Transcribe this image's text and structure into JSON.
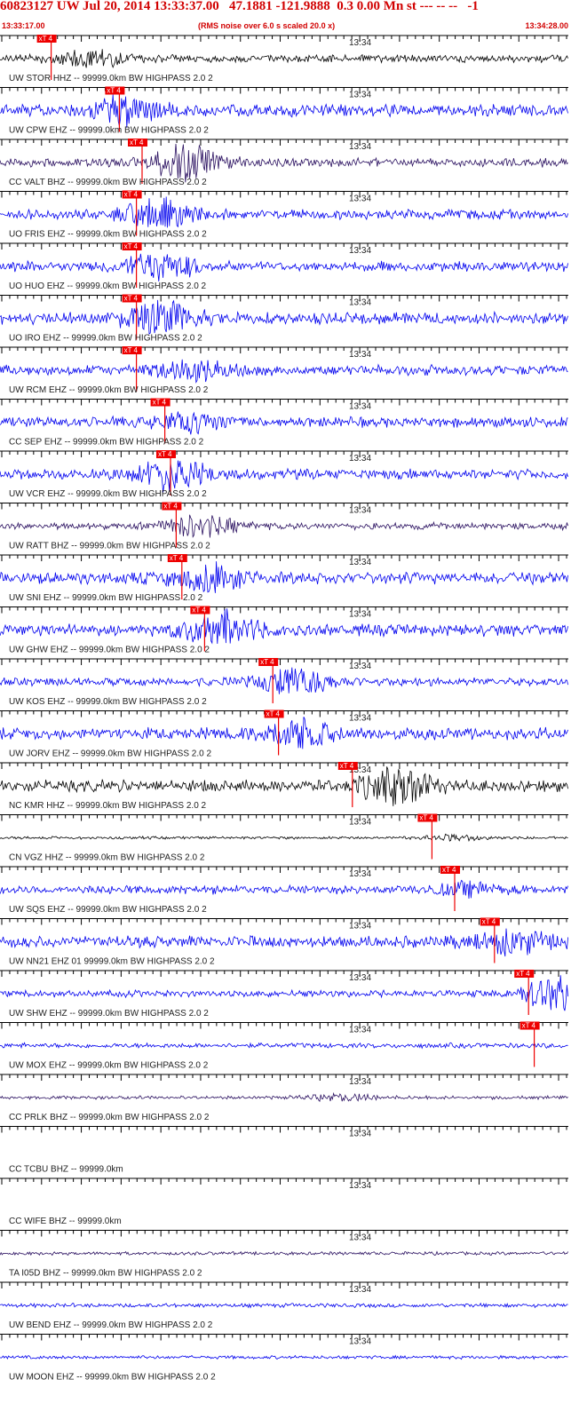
{
  "header": {
    "title": "60823127 UW Jul 20, 2014 13:33:37.00   47.1881 -121.9888  0.3 0.00 Mn st --- -- --   -1",
    "start_time": "13:33:17.00",
    "note": "(RMS noise over 6.0 s scaled 20.0 x)",
    "end_time": "13:34:28.00"
  },
  "tick_label": "13:34",
  "pick_label": "xT 4",
  "colors": {
    "header": "#d10000",
    "pick": "#ee0000",
    "axis": "#000000",
    "blue": "#0000ee",
    "navy": "#2a1060",
    "black": "#000000"
  },
  "channels": [
    {
      "label": "UW STOR HHZ -- 99999.0km BW  HIGHPASS  2.0  2",
      "color": "black",
      "pick": 0.09,
      "burst": 0.16,
      "amp": 0.22,
      "bamp": 0.5
    },
    {
      "label": "UW CPW EHZ -- 99999.0km BW  HIGHPASS  2.0  2",
      "color": "blue",
      "pick": 0.21,
      "burst": 0.22,
      "amp": 0.35,
      "bamp": 0.7
    },
    {
      "label": "CC VALT BHZ -- 99999.0km BW  HIGHPASS  2.0  2",
      "color": "navy",
      "pick": 0.25,
      "burst": 0.33,
      "amp": 0.25,
      "bamp": 1.0
    },
    {
      "label": "UO FRIS EHZ -- 99999.0km BW  HIGHPASS  2.0  2",
      "color": "blue",
      "pick": 0.24,
      "burst": 0.28,
      "amp": 0.28,
      "bamp": 0.8
    },
    {
      "label": "UO HUO EHZ -- 99999.0km BW  HIGHPASS  2.0  2",
      "color": "blue",
      "pick": 0.24,
      "burst": 0.28,
      "amp": 0.3,
      "bamp": 0.7
    },
    {
      "label": "UO IRO EHZ -- 99999.0km BW  HIGHPASS  2.0  2",
      "color": "blue",
      "pick": 0.24,
      "burst": 0.28,
      "amp": 0.35,
      "bamp": 0.9
    },
    {
      "label": "UW RCM EHZ -- 99999.0km BW  HIGHPASS  2.0  2",
      "color": "blue",
      "pick": 0.24,
      "burst": 0.34,
      "amp": 0.3,
      "bamp": 0.6
    },
    {
      "label": "CC SEP EHZ -- 99999.0km BW  HIGHPASS  2.0  2",
      "color": "blue",
      "pick": 0.29,
      "burst": 0.34,
      "amp": 0.3,
      "bamp": 0.5
    },
    {
      "label": "UW VCR EHZ -- 99999.0km BW  HIGHPASS  2.0  2",
      "color": "blue",
      "pick": 0.3,
      "burst": 0.3,
      "amp": 0.3,
      "bamp": 0.9
    },
    {
      "label": "UW RATT BHZ -- 99999.0km BW  HIGHPASS  2.0  2",
      "color": "navy",
      "pick": 0.31,
      "burst": 0.35,
      "amp": 0.2,
      "bamp": 0.6
    },
    {
      "label": "UW SNI EHZ -- 99999.0km BW  HIGHPASS  2.0  2",
      "color": "blue",
      "pick": 0.32,
      "burst": 0.37,
      "amp": 0.35,
      "bamp": 0.7
    },
    {
      "label": "UW GHW EHZ -- 99999.0km BW  HIGHPASS  2.0  2",
      "color": "blue",
      "pick": 0.36,
      "burst": 0.39,
      "amp": 0.35,
      "bamp": 0.9
    },
    {
      "label": "UW KOS EHZ -- 99999.0km BW  HIGHPASS  2.0  2",
      "color": "blue",
      "pick": 0.48,
      "burst": 0.52,
      "amp": 0.25,
      "bamp": 0.8
    },
    {
      "label": "UW JORV EHZ -- 99999.0km BW  HIGHPASS  2.0  2",
      "color": "blue",
      "pick": 0.49,
      "burst": 0.52,
      "amp": 0.35,
      "bamp": 0.8
    },
    {
      "label": "NC KMR HHZ -- 99999.0km BW  HIGHPASS  2.0  2",
      "color": "black",
      "pick": 0.62,
      "burst": 0.7,
      "amp": 0.35,
      "bamp": 1.0
    },
    {
      "label": "CN VGZ HHZ -- 99999.0km BW  HIGHPASS  2.0  2",
      "color": "black",
      "pick": 0.76,
      "burst": 0.8,
      "amp": 0.08,
      "bamp": 0.15
    },
    {
      "label": "UW SQS EHZ -- 99999.0km BW  HIGHPASS  2.0  2",
      "color": "blue",
      "pick": 0.8,
      "burst": 0.82,
      "amp": 0.25,
      "bamp": 0.3
    },
    {
      "label": "UW NN21 EHZ 01 99999.0km BW  HIGHPASS  2.0  2",
      "color": "blue",
      "pick": 0.87,
      "burst": 0.9,
      "amp": 0.35,
      "bamp": 0.6
    },
    {
      "label": "UW SHW EHZ -- 99999.0km BW  HIGHPASS  2.0  2",
      "color": "blue",
      "pick": 0.93,
      "burst": 0.98,
      "amp": 0.2,
      "bamp": 1.0
    },
    {
      "label": "UW MOX EHZ -- 99999.0km BW  HIGHPASS  2.0  2",
      "color": "blue",
      "pick": 0.94,
      "burst": null,
      "amp": 0.15,
      "bamp": 0
    },
    {
      "label": "CC PRLK BHZ -- 99999.0km BW  HIGHPASS  2.0  2",
      "color": "navy",
      "pick": null,
      "burst": 0.6,
      "amp": 0.1,
      "bamp": 0.2
    },
    {
      "label": "CC TCBU BHZ -- 99999.0km",
      "color": "none",
      "pick": null,
      "burst": null,
      "amp": 0,
      "bamp": 0
    },
    {
      "label": "CC WIFE BHZ -- 99999.0km",
      "color": "none",
      "pick": null,
      "burst": null,
      "amp": 0,
      "bamp": 0
    },
    {
      "label": "TA I05D BHZ -- 99999.0km BW  HIGHPASS  2.0  2",
      "color": "navy",
      "pick": null,
      "burst": null,
      "amp": 0.1,
      "bamp": 0
    },
    {
      "label": "UW BEND EHZ -- 99999.0km BW  HIGHPASS  2.0  2",
      "color": "blue",
      "pick": null,
      "burst": null,
      "amp": 0.12,
      "bamp": 0
    },
    {
      "label": "UW MOON EHZ -- 99999.0km BW  HIGHPASS  2.0  2",
      "color": "blue",
      "pick": null,
      "burst": null,
      "amp": 0.1,
      "bamp": 0
    }
  ]
}
